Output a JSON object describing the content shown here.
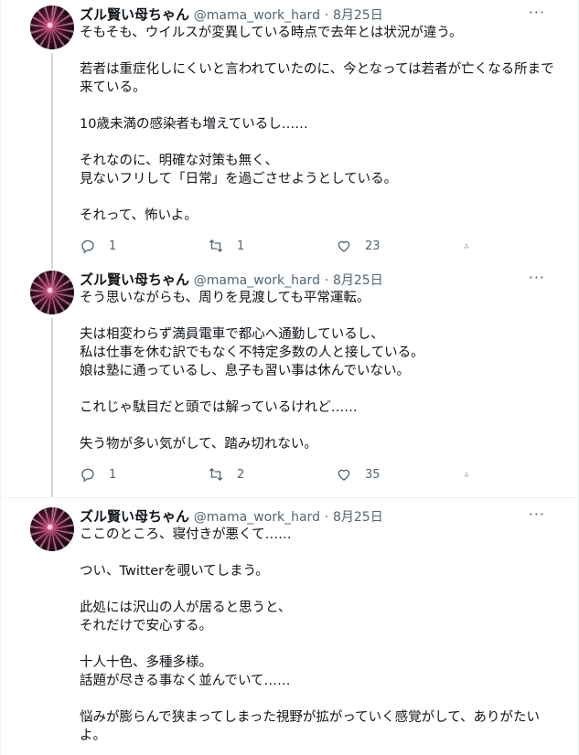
{
  "tweets": [
    {
      "name": "ズル賢い母ちゃん",
      "handle": "@mama_work_hard",
      "dot": "·",
      "date": "8月25日",
      "paragraphs": [
        "そもそも、ウイルスが変異している時点で去年とは状況が違う。",
        "若者は重症化しにくいと言われていたのに、今となっては若者が亡くなる所まで来ている。",
        "10歳未満の感染者も増えているし……",
        "それなのに、明確な対策も無く、\n見ないフリして「日常」を過ごさせようとしている。",
        "それって、怖いよ。"
      ],
      "replies": "1",
      "retweets": "1",
      "likes": "23"
    },
    {
      "name": "ズル賢い母ちゃん",
      "handle": "@mama_work_hard",
      "dot": "·",
      "date": "8月25日",
      "paragraphs": [
        "そう思いながらも、周りを見渡しても平常運転。",
        "夫は相変わらず満員電車で都心へ通勤しているし、\n私は仕事を休む訳でもなく不特定多数の人と接している。\n娘は塾に通っているし、息子も習い事は休んでいない。",
        "これじゃ駄目だと頭では解っているけれど……",
        "失う物が多い気がして、踏み切れない。"
      ],
      "replies": "1",
      "retweets": "2",
      "likes": "35"
    },
    {
      "name": "ズル賢い母ちゃん",
      "handle": "@mama_work_hard",
      "dot": "·",
      "date": "8月25日",
      "paragraphs": [
        "ここのところ、寝付きが悪くて……",
        "つい、Twitterを覗いてしまう。",
        "此処には沢山の人が居ると思うと、\nそれだけで安心する。",
        "十人十色、多種多様。\n話題が尽きる事なく並んでいて……",
        "悩みが膨らんで狭まってしまった視野が拡がっていく感覚がして、ありがたいよ。"
      ]
    }
  ],
  "more_glyph": "···",
  "icons": {
    "reply": "reply-icon",
    "retweet": "retweet-icon",
    "like": "like-icon",
    "share": "share-icon",
    "more": "more-icon"
  },
  "colors": {
    "text": "#0f1419",
    "secondary": "#536471",
    "thread_line": "#cfd9de",
    "divider": "#eff3f4"
  }
}
